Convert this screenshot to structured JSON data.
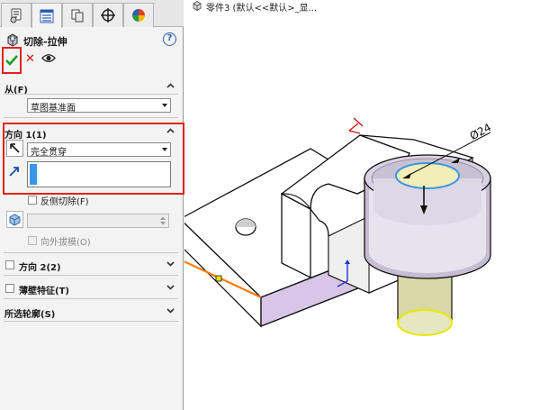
{
  "panel": {
    "tabs": [
      {
        "icon": "feature-manager-icon"
      },
      {
        "icon": "property-manager-icon"
      },
      {
        "icon": "configuration-manager-icon"
      },
      {
        "icon": "dimxpert-icon"
      },
      {
        "icon": "display-manager-icon"
      }
    ],
    "feature_title": "切除-拉伸",
    "from_section": {
      "label": "从(F)",
      "select_value": "草图基准面"
    },
    "direction1": {
      "label": "方向 1(1)",
      "end_condition": "完全贯穿",
      "flip_side_label": "反侧切除(F)",
      "draft_outward_label": "向外拔模(O)"
    },
    "direction2": {
      "label": "方向 2(2)"
    },
    "thin_feature": {
      "label": "薄壁特征(T)"
    },
    "selected_contours": {
      "label": "所选轮廓(S)"
    }
  },
  "viewport": {
    "tree_item": "零件3 (默认<<默认>_显...",
    "dimension_label": "Ø24"
  },
  "colors": {
    "highlight_box": "#e32020",
    "accept": "#1e9e1e",
    "cancel": "#d01010",
    "selection_blue": "#3a96e6",
    "edge_orange": "#ff7a00",
    "edge_yellow": "#e8e800",
    "cut_face_purple": "#d8c6e6"
  }
}
